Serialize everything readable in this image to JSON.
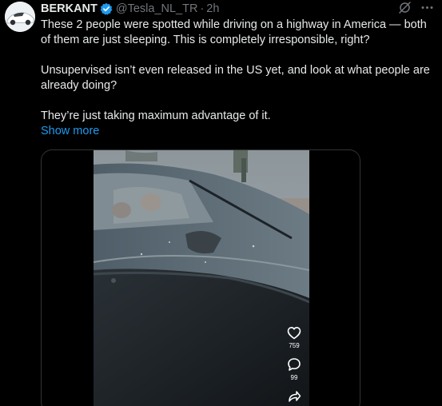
{
  "author": {
    "display_name": "BERKANT",
    "handle": "@Tesla_NL_TR",
    "separator": "·",
    "time": "2h",
    "verified_color": "#1d9bf0",
    "avatar_icon": "white-car-avatar"
  },
  "top_actions": {
    "grok_icon": "grok-slash-icon",
    "more_icon": "more-dots-icon"
  },
  "tweet": {
    "paragraphs": [
      "These 2 people were spotted while driving on a highway in America — both of them are just sleeping. This is completely irresponsible, right?",
      "Unsupervised isn’t even released in the US yet, and look at what people are already doing?",
      "They’re just taking maximum advantage of it."
    ],
    "show_more": "Show more"
  },
  "video": {
    "description_icon": "car-driving-video",
    "likes": "759",
    "comments": "99",
    "like_icon": "heart-icon",
    "comment_icon": "comment-bubble-icon",
    "share_icon": "share-arrow-icon"
  },
  "colors": {
    "background": "#000000",
    "text": "#e7e9ea",
    "muted": "#71767b",
    "link": "#1d9bf0"
  }
}
